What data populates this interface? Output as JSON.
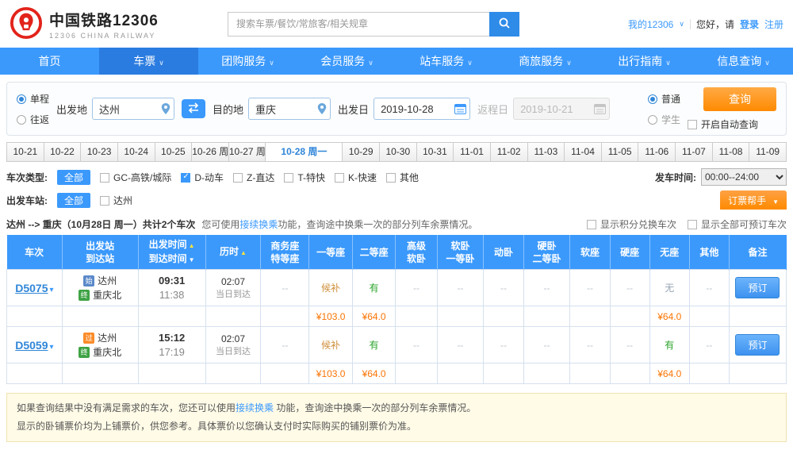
{
  "header": {
    "logo_title": "中国铁路12306",
    "logo_subtitle": "12306 CHINA RAILWAY",
    "search_placeholder": "搜索车票/餐饮/常旅客/相关规章",
    "my_account": "我的12306",
    "greeting": "您好，请",
    "login": "登录",
    "register": "注册"
  },
  "nav": {
    "items": [
      {
        "label": "首页"
      },
      {
        "label": "车票"
      },
      {
        "label": "团购服务"
      },
      {
        "label": "会员服务"
      },
      {
        "label": "站车服务"
      },
      {
        "label": "商旅服务"
      },
      {
        "label": "出行指南"
      },
      {
        "label": "信息查询"
      }
    ]
  },
  "query": {
    "trip_single": "单程",
    "trip_round": "往返",
    "from_label": "出发地",
    "from_value": "达州",
    "to_label": "目的地",
    "to_value": "重庆",
    "depart_label": "出发日",
    "depart_value": "2019-10-28",
    "return_label": "返程日",
    "return_value": "2019-10-21",
    "type_normal": "普通",
    "type_student": "学生",
    "search_button": "查询",
    "auto_query_label": "开启自动查询"
  },
  "date_tabs": {
    "items": [
      "10-21",
      "10-22",
      "10-23",
      "10-24",
      "10-25",
      "10-26 周",
      "10-27 周",
      "10-28 周一",
      "10-29",
      "10-30",
      "10-31",
      "11-01",
      "11-02",
      "11-03",
      "11-04",
      "11-05",
      "11-06",
      "11-07",
      "11-08",
      "11-09"
    ],
    "selected": "10-28 周一"
  },
  "filters": {
    "type_label": "车次类型:",
    "type_all": "全部",
    "types": [
      {
        "label": "GC-高铁/城际",
        "checked": false
      },
      {
        "label": "D-动车",
        "checked": true
      },
      {
        "label": "Z-直达",
        "checked": false
      },
      {
        "label": "T-特快",
        "checked": false
      },
      {
        "label": "K-快速",
        "checked": false
      },
      {
        "label": "其他",
        "checked": false
      }
    ],
    "depart_time_label": "发车时间:",
    "depart_time_value": "00:00--24:00",
    "station_label": "出发车站:",
    "station_all": "全部",
    "stations": [
      {
        "label": "达州",
        "checked": false
      }
    ],
    "helper_button": "订票帮手"
  },
  "summary": {
    "route": "达州 --> 重庆（10月28日 周一）共计2个车次",
    "tip_prefix": "您可使用",
    "tip_link": "接续换乘",
    "tip_suffix": "功能，查询途中换乘一次的部分列车余票情况。",
    "show_points_label": "显示积分兑换车次",
    "show_all_label": "显示全部可预订车次"
  },
  "table": {
    "headers": {
      "train": "车次",
      "station_1": "出发站",
      "station_2": "到达站",
      "time_1": "出发时间",
      "time_2": "到达时间",
      "duration": "历时",
      "business_1": "商务座",
      "business_2": "特等座",
      "first_class": "一等座",
      "second_class": "二等座",
      "premium_1": "高级",
      "premium_2": "软卧",
      "soft_1": "软卧",
      "soft_2": "一等卧",
      "dong": "动卧",
      "hard_1": "硬卧",
      "hard_2": "二等卧",
      "soft_seat": "软座",
      "hard_seat": "硬座",
      "no_seat": "无座",
      "other": "其他",
      "remark": "备注"
    }
  },
  "trains": [
    {
      "train_no": "D5075",
      "from_badge": "始",
      "from_station": "达州",
      "depart_time": "09:31",
      "to_badge": "终",
      "to_station": "重庆北",
      "arrive_time": "11:38",
      "duration": "02:07",
      "arrive_day": "当日到达",
      "business": "--",
      "first_class": "候补",
      "second_class": "有",
      "premium_sleeper": "--",
      "soft_sleeper": "--",
      "dong_sleeper": "--",
      "hard_sleeper": "--",
      "soft_seat": "--",
      "hard_seat": "--",
      "no_seat": "无",
      "other": "--",
      "book_label": "预订",
      "price_first": "¥103.0",
      "price_second": "¥64.0",
      "price_no_seat": "¥64.0"
    },
    {
      "train_no": "D5059",
      "from_badge": "过",
      "from_station": "达州",
      "depart_time": "15:12",
      "to_badge": "终",
      "to_station": "重庆北",
      "arrive_time": "17:19",
      "duration": "02:07",
      "arrive_day": "当日到达",
      "business": "--",
      "first_class": "候补",
      "second_class": "有",
      "premium_sleeper": "--",
      "soft_sleeper": "--",
      "dong_sleeper": "--",
      "hard_sleeper": "--",
      "soft_seat": "--",
      "hard_seat": "--",
      "no_seat": "有",
      "other": "--",
      "book_label": "预订",
      "price_first": "¥103.0",
      "price_second": "¥64.0",
      "price_no_seat": "¥64.0"
    }
  ],
  "notice": {
    "line1_prefix": "如果查询结果中没有满足需求的车次，您还可以使用",
    "line1_link": "接续换乘",
    "line1_suffix": " 功能，查询途中换乘一次的部分列车余票情况。",
    "line2": "显示的卧铺票价均为上铺票价，供您参考。具体票价以您确认支付时实际购买的铺别票价为准。"
  },
  "colors": {
    "primary_blue": "#3b99fc",
    "active_nav_blue": "#2b7ce0",
    "accent_orange": "#ff8a00",
    "available_green": "#2ba52b",
    "price_orange": "#fb7403"
  }
}
